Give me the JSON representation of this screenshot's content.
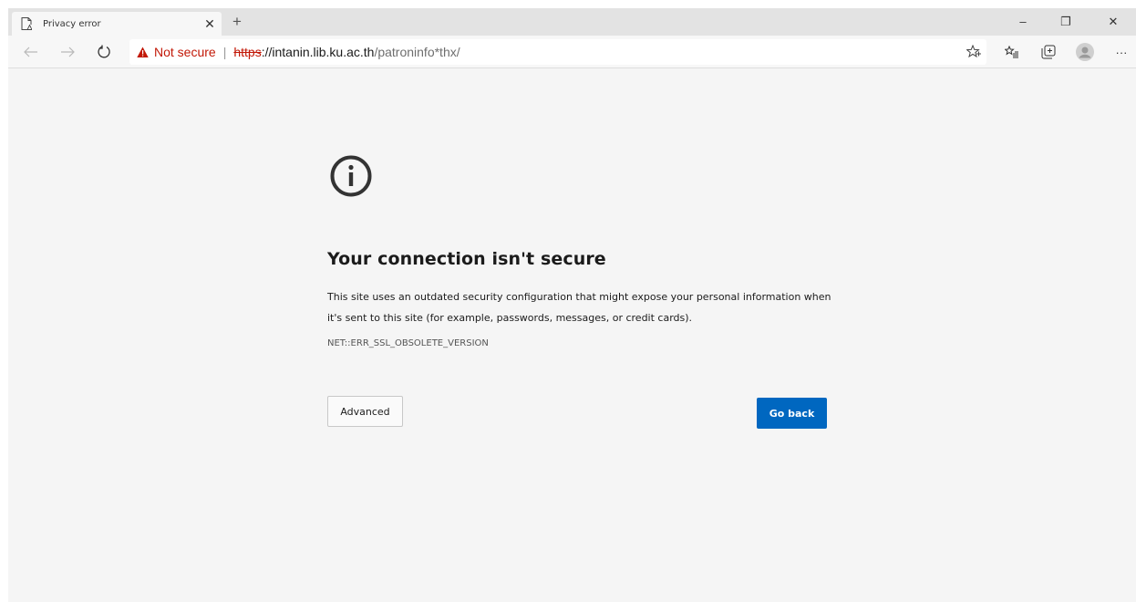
{
  "tab": {
    "title": "Privacy error",
    "close_icon": "close-icon",
    "favicon": "page-warning-icon"
  },
  "new_tab_label": "+",
  "window_controls": {
    "minimize": "–",
    "restore": "❐",
    "close": "✕"
  },
  "addressbar": {
    "security_label": "Not secure",
    "separator": "|",
    "url_scheme": "https",
    "url_host": "://intanin.lib.ku.ac.th",
    "url_path": "/patroninfo*thx/"
  },
  "toolbar_icons": [
    "back-icon",
    "forward-icon",
    "refresh-icon",
    "favorite-star-icon",
    "favorites-list-icon",
    "collections-icon",
    "profile-icon",
    "more-icon"
  ],
  "toolbar_more": "···",
  "error_page": {
    "heading": "Your connection isn't secure",
    "description": "This site uses an outdated security configuration that might expose your personal information when it's sent to this site (for example, passwords, messages, or credit cards).",
    "error_code": "NET::ERR_SSL_OBSOLETE_VERSION",
    "advanced_label": "Advanced",
    "go_back_label": "Go back"
  },
  "colors": {
    "accent": "#0067c0",
    "warning": "#c21807",
    "page_bg": "#f5f5f5"
  }
}
